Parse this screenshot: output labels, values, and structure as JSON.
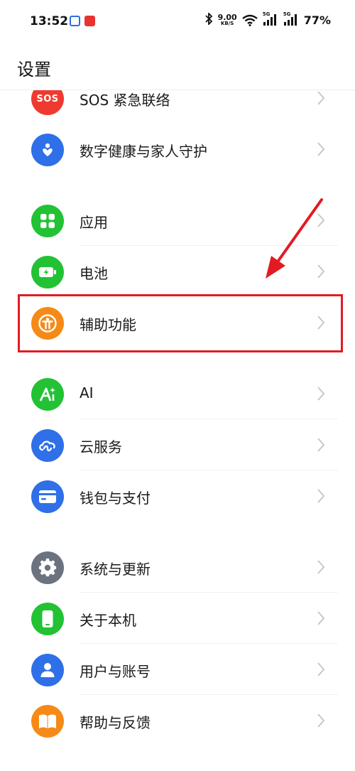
{
  "status_bar": {
    "time": "13:52",
    "net_speed_value": "9.00",
    "net_speed_unit": "KB/S",
    "signal1_label": "5G",
    "signal2_label": "5G",
    "battery": "77%"
  },
  "header": {
    "title": "设置"
  },
  "items": [
    {
      "label": "SOS 紧急联络",
      "icon": "sos-icon",
      "icon_text": "SOS",
      "color": "#ef3b2f"
    },
    {
      "label": "数字健康与家人守护",
      "icon": "heart-shield-icon",
      "color": "#2f6fe8"
    },
    {
      "label": "应用",
      "icon": "apps-grid-icon",
      "color": "#22c234"
    },
    {
      "label": "电池",
      "icon": "battery-icon",
      "color": "#22c234"
    },
    {
      "label": "辅助功能",
      "icon": "accessibility-icon",
      "color": "#f58a17"
    },
    {
      "label": "AI",
      "icon": "ai-sparkle-icon",
      "color": "#22c234"
    },
    {
      "label": "云服务",
      "icon": "cloud-infinity-icon",
      "color": "#2f6fe8"
    },
    {
      "label": "钱包与支付",
      "icon": "wallet-card-icon",
      "color": "#2f6fe8"
    },
    {
      "label": "系统与更新",
      "icon": "gear-icon",
      "color": "#6c7380"
    },
    {
      "label": "关于本机",
      "icon": "phone-icon",
      "color": "#22c234"
    },
    {
      "label": "用户与账号",
      "icon": "user-icon",
      "color": "#2f6fe8"
    },
    {
      "label": "帮助与反馈",
      "icon": "book-icon",
      "color": "#f58a17"
    }
  ],
  "annotation": {
    "highlight_color": "#e21b23"
  }
}
